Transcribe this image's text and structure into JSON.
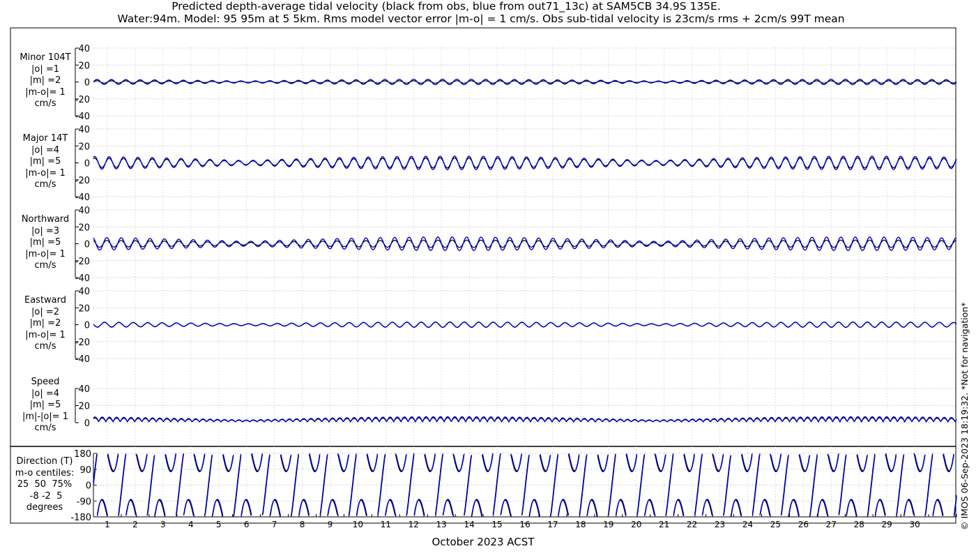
{
  "title": {
    "line1": "Predicted depth-average tidal velocity (black from obs, blue from out71_13c) at SAM5CB 34.9S 135E.",
    "line2": "Water:94m. Model: 95 95m at 5 5km. Rms model vector error |m-o| = 1 cm/s. Obs sub-tidal velocity is 23cm/s rms + 2cm/s 99T mean"
  },
  "credit": "© IMOS 06-Sep-2023 18:19:32. *Not for navigation*",
  "chart_data": {
    "type": "line",
    "xlabel": "October 2023 ACST",
    "x_ticks": [
      "1",
      "2",
      "3",
      "4",
      "5",
      "6",
      "7",
      "8",
      "9",
      "10",
      "11",
      "12",
      "13",
      "14",
      "15",
      "16",
      "17",
      "18",
      "19",
      "20",
      "21",
      "22",
      "23",
      "24",
      "25",
      "26",
      "27",
      "28",
      "29",
      "30"
    ],
    "legend_note": "black from obs, blue from out71_13c",
    "series_colors": {
      "obs": "#000000",
      "model": "#0000cc"
    },
    "grid": "dotted",
    "panels": [
      {
        "label_lines": [
          "Minor 104T",
          "|o| =1",
          "|m| =2",
          "|m-o|= 1",
          "cm/s"
        ],
        "ylim": [
          -40,
          40
        ],
        "yticks": [
          "40",
          "20",
          "0",
          "-20",
          "-40"
        ],
        "approx_amplitude_obs": 1,
        "approx_amplitude_model": 2
      },
      {
        "label_lines": [
          "Major 14T",
          "|o| =4",
          "|m| =5",
          "|m-o|= 1",
          "cm/s"
        ],
        "ylim": [
          -40,
          40
        ],
        "yticks": [
          "40",
          "20",
          "0",
          "-20",
          "-40"
        ],
        "approx_amplitude_obs": 4,
        "approx_amplitude_model": 5
      },
      {
        "label_lines": [
          "Northward",
          "|o| =3",
          "|m| =5",
          "|m-o|= 1",
          "cm/s"
        ],
        "ylim": [
          -40,
          40
        ],
        "yticks": [
          "40",
          "20",
          "0",
          "-20",
          "-40"
        ],
        "approx_amplitude_obs": 3,
        "approx_amplitude_model": 5
      },
      {
        "label_lines": [
          "Eastward",
          "|o| =2",
          "|m| =2",
          "|m-o|= 1",
          "cm/s"
        ],
        "ylim": [
          -40,
          40
        ],
        "yticks": [
          "40",
          "20",
          "0",
          "-20",
          "-40"
        ],
        "approx_amplitude_obs": 2,
        "approx_amplitude_model": 2
      },
      {
        "label_lines": [
          "Speed",
          "|o| =4",
          "|m| =5",
          "|m|-|o|= 1",
          "cm/s"
        ],
        "ylim": [
          0,
          40
        ],
        "yticks": [
          "40",
          "20",
          "0"
        ],
        "approx_amplitude_obs": 4,
        "approx_amplitude_model": 5
      }
    ],
    "direction_panel": {
      "label_lines": [
        "Direction (T)",
        "m-o centiles:",
        "25  50  75%",
        " -8 -2  5",
        "degrees"
      ],
      "ylim": [
        -180,
        180
      ],
      "yticks": [
        "180",
        "90",
        "0",
        "-90",
        "-180"
      ]
    }
  }
}
